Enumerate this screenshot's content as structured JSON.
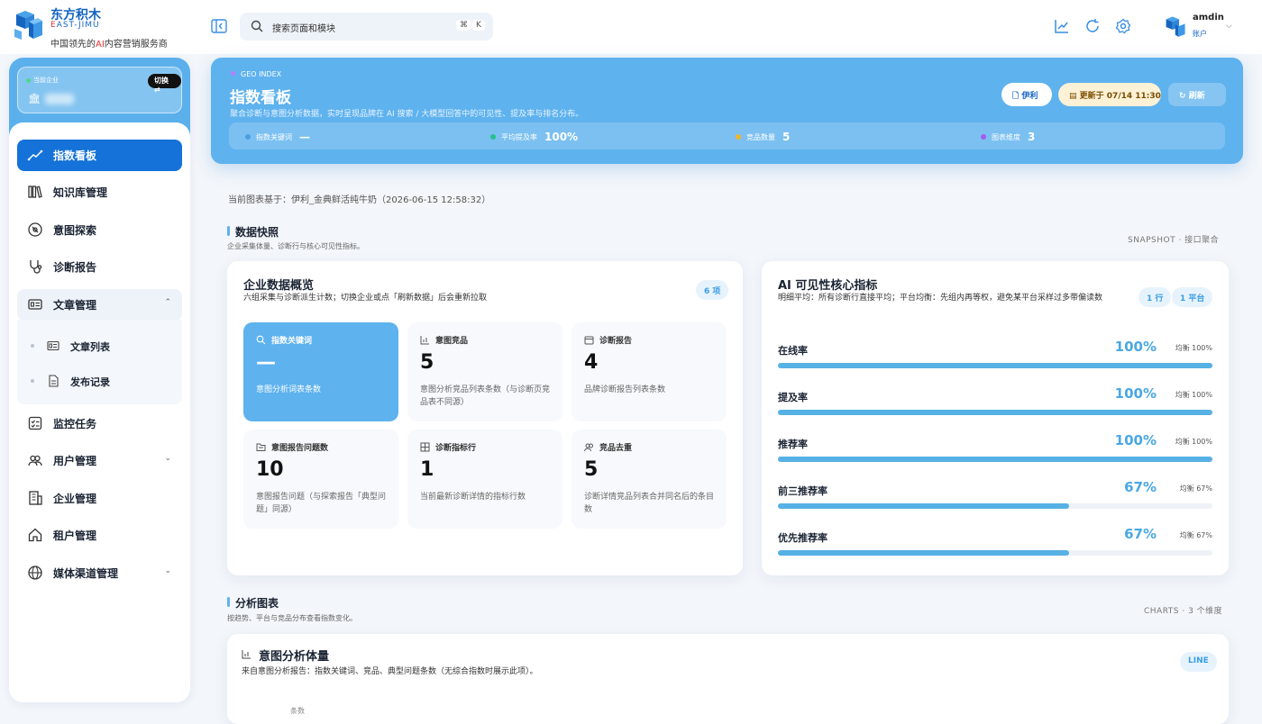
{
  "brand": {
    "name": "东方积木",
    "sub_prefix": "E",
    "sub_rest": "AST-JIMU",
    "tagline_pre": "中国领先的",
    "tagline_ai": "AI",
    "tagline_post": "内容营销服务商"
  },
  "search": {
    "placeholder": "搜索页面和模块",
    "key1": "⌘",
    "key2": "K"
  },
  "topbar_icons": [
    "trend-chart-icon",
    "refresh-icon",
    "settings-gear-icon"
  ],
  "user": {
    "name": "amdin",
    "role": "账户"
  },
  "tenant": {
    "label": "当前企业",
    "switch_label": "切换 ⇄"
  },
  "nav": {
    "items": [
      {
        "label": "指数看板",
        "icon": "trend-line-icon"
      },
      {
        "label": "知识库管理",
        "icon": "library-books-icon"
      },
      {
        "label": "意图探索",
        "icon": "compass-icon"
      },
      {
        "label": "诊断报告",
        "icon": "stethoscope-icon"
      },
      {
        "label": "文章管理",
        "icon": "article-card-icon"
      },
      {
        "label": "监控任务",
        "icon": "checklist-icon"
      },
      {
        "label": "用户管理",
        "icon": "users-icon"
      },
      {
        "label": "企业管理",
        "icon": "building-icon"
      },
      {
        "label": "租户管理",
        "icon": "home-icon"
      },
      {
        "label": "媒体渠道管理",
        "icon": "globe-icon"
      }
    ],
    "sub_items": [
      {
        "label": "文章列表",
        "icon": "list-card-icon"
      },
      {
        "label": "发布记录",
        "icon": "document-icon"
      }
    ]
  },
  "hero": {
    "tag": "GEO INDEX",
    "title": "指数看板",
    "desc": "聚合诊断与意图分析数据，实时呈现品牌在 AI 搜索 / 大模型回答中的可见性、提及率与排名分布。",
    "brand_btn": "伊利",
    "updated_btn": "更新于 07/14 11:30",
    "refresh_btn": "刷新",
    "stats": [
      {
        "label": "指数关键词",
        "value": "—",
        "color": "#4a9fe0"
      },
      {
        "label": "平均提及率",
        "value": "100%",
        "color": "#25c08a"
      },
      {
        "label": "竞品数量",
        "value": "5",
        "color": "#f0b429"
      },
      {
        "label": "图表维度",
        "value": "3",
        "color": "#a35cf0"
      }
    ]
  },
  "basis": "当前图表基于：伊利_金典鲜活纯牛奶（2026-06-15 12:58:32）",
  "snapshot": {
    "title": "数据快照",
    "desc": "企业采集体量、诊断行与核心可见性指标。",
    "right": "SNAPSHOT · 接口聚合"
  },
  "overview": {
    "title": "企业数据概览",
    "sub": "六组采集与诊断派生计数；切换企业或点「刷新数据」后会重新拉取",
    "pill": "6 项",
    "tiles": [
      {
        "label": "指数关键词",
        "value": "—",
        "desc": "意图分析词表条数",
        "icon": "search-icon"
      },
      {
        "label": "意图竞品",
        "value": "5",
        "desc": "意图分析竞品列表条数（与诊断页竞品表不同源）",
        "icon": "bar-chart-icon"
      },
      {
        "label": "诊断报告",
        "value": "4",
        "desc": "品牌诊断报告列表条数",
        "icon": "calendar-icon"
      },
      {
        "label": "意图报告问题数",
        "value": "10",
        "desc": "意图报告问题（与探索报告「典型问题」同源）",
        "icon": "folder-icon"
      },
      {
        "label": "诊断指标行",
        "value": "1",
        "desc": "当前最新诊断详情的指标行数",
        "icon": "grid-icon"
      },
      {
        "label": "竞品去重",
        "value": "5",
        "desc": "诊断详情竞品列表合并同名后的条目数",
        "icon": "users-icon"
      }
    ]
  },
  "ai_metrics": {
    "title": "AI 可见性核心指标",
    "sub": "明细平均：所有诊断行直接平均；平台均衡：先组内再等权，避免某平台采样过多带偏读数",
    "pill1": "1 行",
    "pill2": "1 平台",
    "rows": [
      {
        "label": "在线率",
        "value": "100%",
        "avg": "均衡 100%",
        "fill": 1.0
      },
      {
        "label": "提及率",
        "value": "100%",
        "avg": "均衡 100%",
        "fill": 1.0
      },
      {
        "label": "推荐率",
        "value": "100%",
        "avg": "均衡 100%",
        "fill": 1.0
      },
      {
        "label": "前三推荐率",
        "value": "67%",
        "avg": "均衡 67%",
        "fill": 0.67
      },
      {
        "label": "优先推荐率",
        "value": "67%",
        "avg": "均衡 67%",
        "fill": 0.67
      }
    ]
  },
  "charts": {
    "title": "分析图表",
    "desc": "按趋势、平台与竞品分布查看指数变化。",
    "right": "CHARTS · 3 个维度"
  },
  "intent_card": {
    "title": "意图分析体量",
    "sub": "来自意图分析报告：指数关键词、竞品、典型问题条数（无综合指数时展示此项）。",
    "pill": "LINE",
    "axis_label": "条数"
  }
}
